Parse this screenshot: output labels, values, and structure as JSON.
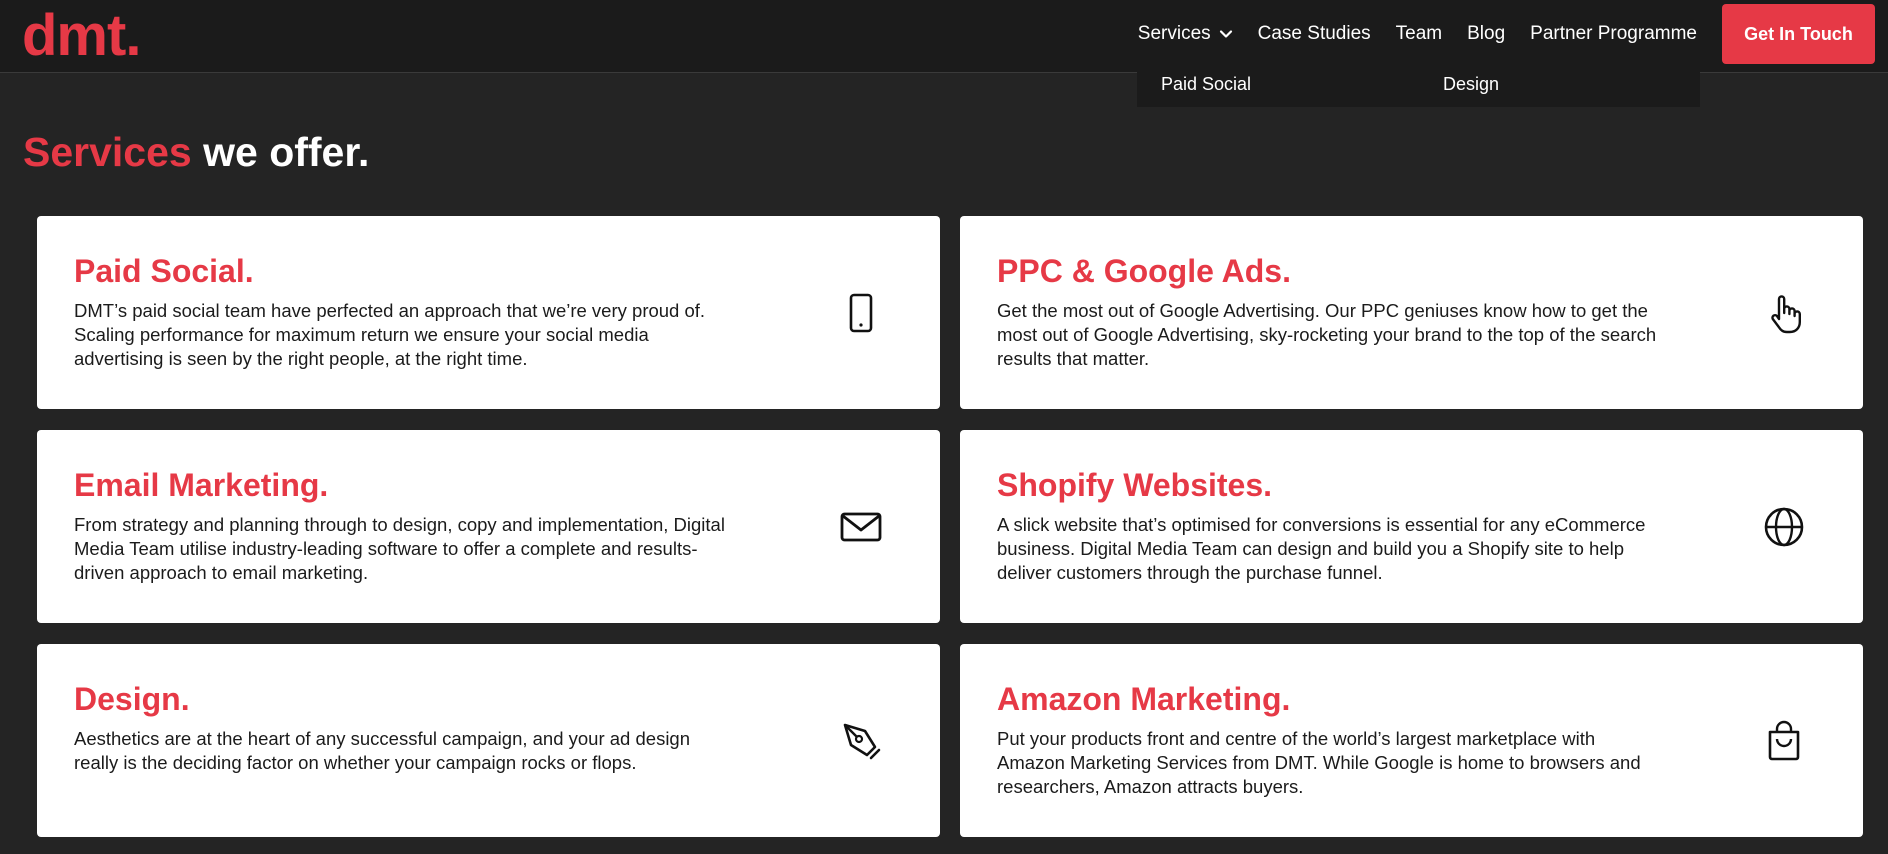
{
  "brand": {
    "logo": "dmt.",
    "accent_color": "#e63946"
  },
  "nav": {
    "items": [
      {
        "label": "Services",
        "icon": "chevron-down-icon"
      },
      {
        "label": "Case Studies"
      },
      {
        "label": "Team"
      },
      {
        "label": "Blog"
      },
      {
        "label": "Partner Programme"
      }
    ],
    "cta": "Get In Touch",
    "dropdown": [
      "Paid Social",
      "Design"
    ]
  },
  "section": {
    "title_accent": "Services",
    "title_rest": " we offer."
  },
  "cards": [
    {
      "title": "Paid Social.",
      "icon": "smartphone-icon",
      "desc": "DMT’s paid social team have perfected an approach that we’re very proud of. Scaling performance for maximum return we ensure your social media advertising is seen by the right people, at the right time."
    },
    {
      "title": "PPC & Google Ads.",
      "icon": "pointer-hand-icon",
      "desc": "Get the most out of Google Advertising. Our PPC geniuses know how to get the most out of Google Advertising, sky-rocketing your brand to the top of the search results that matter."
    },
    {
      "title": "Email Marketing.",
      "icon": "envelope-icon",
      "desc": "From strategy and planning through to design, copy and implementation, Digital Media Team utilise industry-leading software to offer a complete and results-driven approach to email marketing."
    },
    {
      "title": "Shopify Websites.",
      "icon": "globe-icon",
      "desc": "A slick website that’s optimised for conversions is essential for any eCommerce business. Digital Media Team can design and build you a Shopify site to help deliver customers through the purchase funnel."
    },
    {
      "title": "Design.",
      "icon": "pen-nib-icon",
      "desc": "Aesthetics are at the heart of any successful campaign, and your ad design really is the deciding factor on whether your campaign rocks or flops."
    },
    {
      "title": "Amazon Marketing.",
      "icon": "shopping-bag-icon",
      "desc": "Put your products front and centre of the world’s largest marketplace with Amazon Marketing Services from DMT. While Google is home to browsers and researchers, Amazon attracts buyers."
    }
  ]
}
